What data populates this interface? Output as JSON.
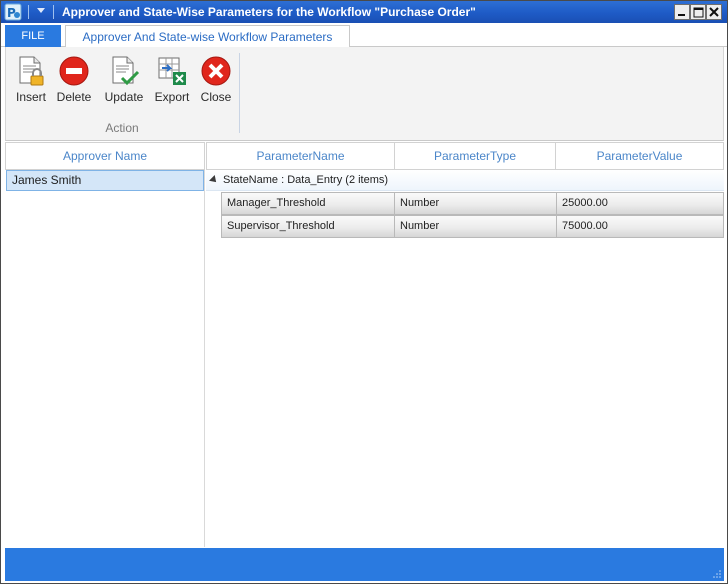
{
  "window": {
    "title": "Approver and State-Wise Parameters for the Workflow \"Purchase Order\""
  },
  "titlebar": {
    "app_icon": "workflow-app-icon",
    "buttons": [
      "minimize",
      "maximize",
      "close"
    ]
  },
  "ribbon": {
    "file_tab": "FILE",
    "main_tab": "Approver And State-wise Workflow Parameters",
    "buttons": [
      {
        "label": "Insert",
        "icon": "insert-document-lock-icon"
      },
      {
        "label": "Delete",
        "icon": "delete-red-minus-icon"
      },
      {
        "label": "Update",
        "icon": "update-document-check-icon"
      },
      {
        "label": "Export",
        "icon": "export-excel-icon"
      },
      {
        "label": "Close",
        "icon": "close-red-x-icon"
      }
    ],
    "group_label": "Action"
  },
  "approver_grid": {
    "header": "Approver Name",
    "rows": [
      "James Smith"
    ]
  },
  "parameter_grid": {
    "headers": [
      "ParameterName",
      "ParameterType",
      "ParameterValue"
    ],
    "group_text": "StateName : Data_Entry (2 items)",
    "rows": [
      {
        "name": "Manager_Threshold",
        "type": "Number",
        "value": "25000.00"
      },
      {
        "name": "Supervisor_Threshold",
        "type": "Number",
        "value": "75000.00"
      }
    ]
  },
  "colors": {
    "title_bar": "#1e5bc6",
    "accent": "#2a7ae0",
    "header_text": "#4b86c9",
    "selection": "#d4e6f8"
  }
}
